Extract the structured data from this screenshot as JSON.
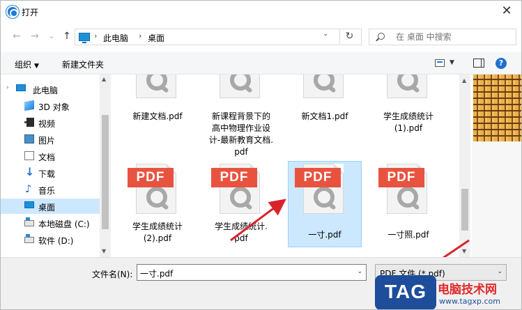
{
  "window": {
    "title": "打开",
    "close_glyph": "✕"
  },
  "nav": {
    "back": "←",
    "forward": "→",
    "recent": "⌄",
    "up": "↑",
    "breadcrumb": [
      "此电脑",
      "桌面"
    ],
    "separator": "›",
    "dropdown": "⌄",
    "refresh": "↻",
    "search_placeholder": "在 桌面 中搜索"
  },
  "toolbar": {
    "organize": "组织",
    "organize_arrow": "▼",
    "new_folder": "新建文件夹",
    "view_arrow": "▼",
    "help": "?"
  },
  "sidebar": {
    "root": "此电脑",
    "items": [
      "3D 对象",
      "视频",
      "图片",
      "文档",
      "下载",
      "音乐",
      "桌面",
      "本地磁盘 (C:)",
      "软件 (D:)"
    ],
    "selected": "桌面",
    "scroll_up": "▲",
    "scroll_down": "▼"
  },
  "files": [
    {
      "name": "新建文档.pdf",
      "pdf_badge": ""
    },
    {
      "name": "新课程背景下的高中物理作业设计-最新教育文档.pdf",
      "pdf_badge": ""
    },
    {
      "name": "新文档1.pdf",
      "pdf_badge": ""
    },
    {
      "name": "学生成绩统计(1).pdf",
      "pdf_badge": ""
    },
    {
      "name": "学生成绩统计(2).pdf",
      "pdf_badge": "PDF"
    },
    {
      "name": "学生成绩统计.pdf",
      "pdf_badge": "PDF"
    },
    {
      "name": "一寸.pdf",
      "pdf_badge": "PDF"
    },
    {
      "name": "一寸照.pdf",
      "pdf_badge": "PDF"
    }
  ],
  "file_lines": {
    "f0": [
      "新建文档.pdf"
    ],
    "f1": [
      "新课程背景下的",
      "高中物理作业设",
      "计-最新教育文档.",
      "pdf"
    ],
    "f2": [
      "新文档1.pdf"
    ],
    "f3": [
      "学生成绩统计",
      "(1).pdf"
    ],
    "f4": [
      "学生成绩统计",
      "(2).pdf"
    ],
    "f5": [
      "学生成绩统计.",
      "pdf"
    ],
    "f6": [
      "一寸.pdf"
    ],
    "f7": [
      "一寸照.pdf"
    ]
  },
  "selected_file": "一寸.pdf",
  "footer": {
    "filename_label": "文件名(N):",
    "filename_value": "一寸.pdf",
    "filetype_value": "PDF 文件 (*.pdf)",
    "dropdown": "⌄"
  },
  "watermark": {
    "line1": "PDF",
    "tag": "TAG",
    "title": "电脑技术网",
    "url": "www.tagxp.com"
  },
  "colors": {
    "accent": "#1e7ad8",
    "selection": "#cce8ff",
    "pdf_red": "#e8533f",
    "arrow_red": "#d9232b",
    "logo_blue": "#1e4d9b"
  }
}
